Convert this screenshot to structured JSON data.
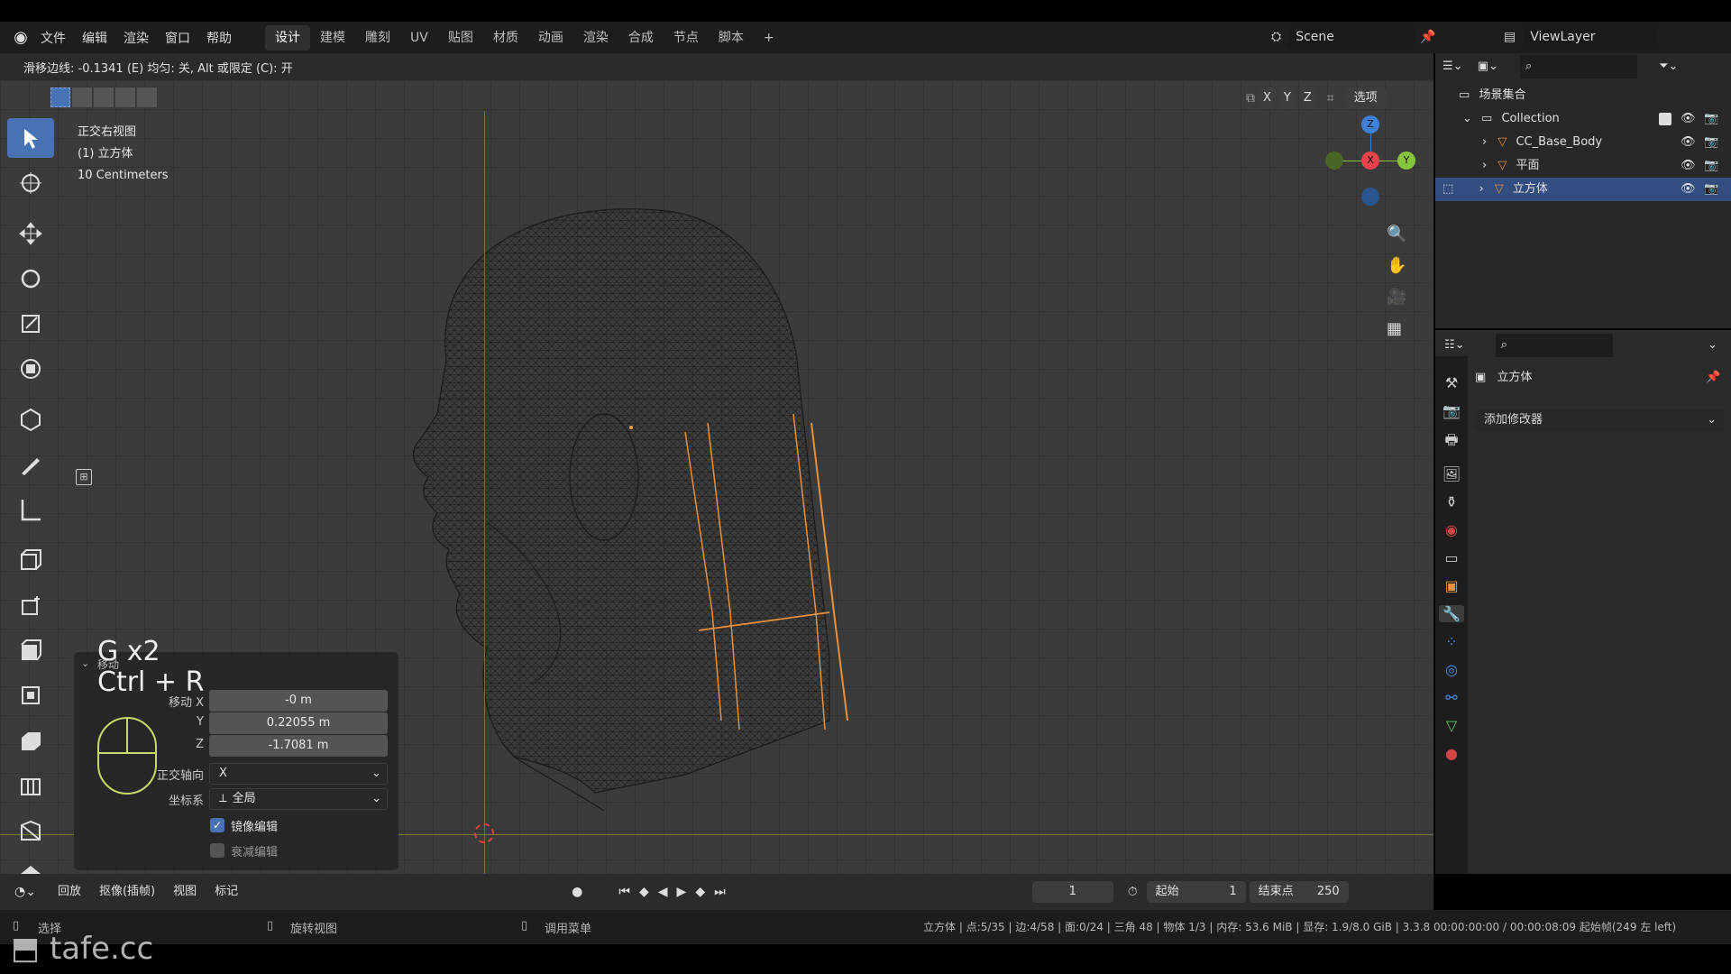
{
  "menu": {
    "items": [
      "文件",
      "编辑",
      "渲染",
      "窗口",
      "帮助"
    ],
    "workspaces": [
      "设计",
      "建模",
      "雕刻",
      "UV",
      "贴图",
      "材质",
      "动画",
      "渲染",
      "合成",
      "节点",
      "脚本"
    ],
    "active_workspace": "设计",
    "add_tab": "+"
  },
  "header_right": {
    "scene": "Scene",
    "view_layer": "ViewLayer"
  },
  "status_line": "滑移边线: -0.1341 (E) 均匀: 关, Alt 或限定 (C): 开",
  "viewport": {
    "view_name": "正交右视图",
    "object_label": "(1) 立方体",
    "scale_label": "10 Centimeters",
    "axis_toggles": [
      "X",
      "Y",
      "Z"
    ],
    "options_label": "选项",
    "gizmo_axes": {
      "z": "Z",
      "x": "X",
      "y": "Y"
    }
  },
  "key_overlay": {
    "line1": "G x2",
    "line2": "Ctrl + R"
  },
  "operator_panel": {
    "title": "移动",
    "move_label": "移动 X",
    "y_label": "Y",
    "z_label": "Z",
    "x_value": "-0 m",
    "y_value": "0.22055 m",
    "z_value": "-1.7081 m",
    "ortho_label": "正交轴向",
    "ortho_value": "X",
    "coord_label": "坐标系",
    "coord_value": "全局",
    "mirror_label": "镜像编辑",
    "mirror_checked": true,
    "falloff_label": "衰减编辑",
    "falloff_checked": false
  },
  "timeline": {
    "playback": "回放",
    "keying": "抠像(插帧)",
    "view": "视图",
    "marker": "标记",
    "current_frame": "1",
    "start_label": "起始",
    "start_value": "1",
    "end_label": "结束点",
    "end_value": "250"
  },
  "statusbar": {
    "select": "选择",
    "rotate": "旋转视图",
    "menu": "调用菜单",
    "stats": "立方体 | 点:5/35 | 边:4/58 | 面:0/24 | 三角 48 | 物体 1/3 | 内存: 53.6 MiB | 显存: 1.9/8.0 GiB | 3.3.8  00:00:00:00 / 00:00:08:09  起始帧(249 左 left)",
    "watermark": "tafe.cc"
  },
  "outliner": {
    "root": "场景集合",
    "collection": "Collection",
    "items": [
      "CC_Base_Body",
      "平面",
      "立方体"
    ],
    "selected": "立方体"
  },
  "properties": {
    "object_name": "立方体",
    "add_modifier": "添加修改器"
  },
  "colors": {
    "accent": "#4772b3",
    "edge_select": "#e8903a",
    "x_axis": "#e8434c",
    "y_axis": "#88c43c",
    "z_axis": "#3f7fd6"
  }
}
